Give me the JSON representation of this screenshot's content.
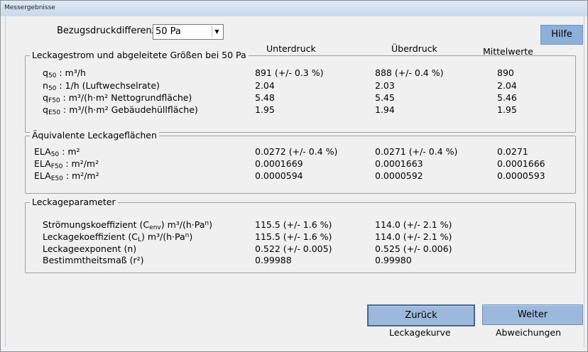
{
  "window": {
    "title": "Messergebnisse"
  },
  "header": {
    "bezug_label": "Bezugsdruckdifferenz",
    "bezug_value": "50 Pa",
    "help_label": "Hilfe",
    "col_unterdruck": "Unterdruck",
    "col_ueberdruck": "Überdruck",
    "col_mittelwerte": "Mittelwerte"
  },
  "leckagestrom": {
    "legend": "Leckagestrom und abgeleitete Größen bei 50 Pa",
    "rows": [
      {
        "sym": "q",
        "sub": "50",
        "rest": " :  m³/h",
        "u": "891  (+/- 0.3 %)",
        "o": "888  (+/- 0.4 %)",
        "m": "890"
      },
      {
        "sym": "n",
        "sub": "50",
        "rest": " :  1/h (Luftwechselrate)",
        "u": "2.04",
        "o": "2.03",
        "m": "2.04"
      },
      {
        "sym": "q",
        "sub": "F50",
        "rest": " :  m³/(h·m² Nettogrundfläche)",
        "u": "5.48",
        "o": "5.45",
        "m": "5.46"
      },
      {
        "sym": "q",
        "sub": "E50",
        "rest": " :  m³/(h·m² Gebäudehüllfläche)",
        "u": "1.95",
        "o": "1.94",
        "m": "1.95"
      }
    ]
  },
  "ela": {
    "legend": "Äquivalente Leckageflächen",
    "rows": [
      {
        "sym": "ELA",
        "sub": "50",
        "rest": " :  m²",
        "u": "0.0272 (+/- 0.4 %)",
        "o": "0.0271 (+/- 0.4 %)",
        "m": "0.0271"
      },
      {
        "sym": "ELA",
        "sub": "F50",
        "rest": " :  m²/m²",
        "u": "0.0001669",
        "o": "0.0001663",
        "m": "0.0001666"
      },
      {
        "sym": "ELA",
        "sub": "E50",
        "rest": " :  m²/m²",
        "u": "0.0000594",
        "o": "0.0000592",
        "m": "0.0000593"
      }
    ]
  },
  "param": {
    "legend": "Leckageparameter",
    "rows": [
      {
        "a": "Strömungskoeffizient (C",
        "sub": "env",
        "b": ")  m³/(h·Pa",
        "sup": "n",
        "c": ")",
        "u": "115.5 (+/- 1.6 %)",
        "o": "114.0 (+/- 2.1 %)"
      },
      {
        "a": "Leckagekoeffizient (C",
        "sub": "L",
        "b": ")  m³/(h·Pa",
        "sup": "n",
        "c": ")",
        "u": "115.5 (+/- 1.6 %)",
        "o": "114.0 (+/- 2.1 %)"
      },
      {
        "a": "Leckageexponent (n)",
        "sub": "",
        "b": "",
        "sup": "",
        "c": "",
        "u": "0.522 (+/- 0.005)",
        "o": "0.525 (+/- 0.006)"
      },
      {
        "a": "Bestimmtheitsmaß (r²)",
        "sub": "",
        "b": "",
        "sup": "",
        "c": "",
        "u": "0.99988",
        "o": "0.99980"
      }
    ]
  },
  "footer": {
    "back_label": "Zurück",
    "next_label": "Weiter",
    "link_leckagekurve": "Leckagekurve",
    "link_abweichungen": "Abweichungen"
  }
}
